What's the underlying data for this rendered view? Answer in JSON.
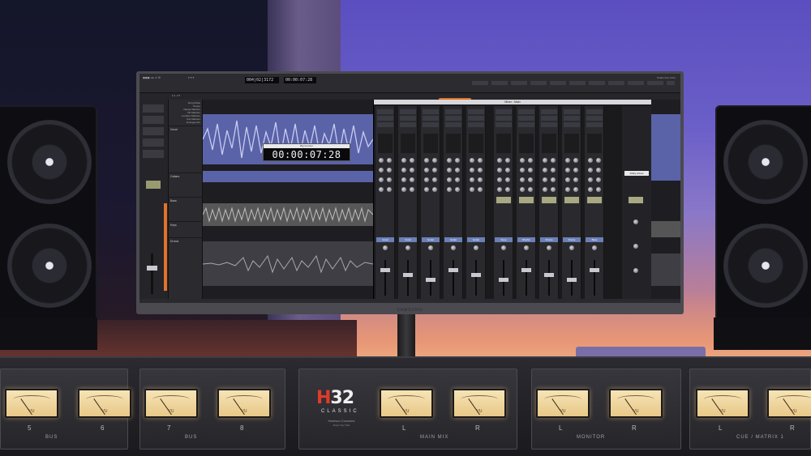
{
  "daw": {
    "transport": {
      "main_counter": "004|02|3172",
      "sub_counter": "00:00:07:28",
      "version": "Studio One 6 Pro"
    },
    "floating_timecode": {
      "title": "Big Counter",
      "value": "00:00:07:28"
    },
    "markers": [
      "Song Mode",
      "Tempo",
      "Range Markers",
      "CD Markers",
      "Location Markers",
      "Cue Markers",
      "Arrangement"
    ],
    "tracks": [
      "Vocal",
      "Guitars",
      "Bass",
      "Keys",
      "Drums"
    ],
    "mixer": {
      "title": "Mixer - Main",
      "channels": [
        "Vocal",
        "Vocal",
        "Guitar",
        "Guitar",
        "Guitar",
        "Keys",
        "Rhythm",
        "Drums",
        "Drums",
        "Bass",
        "Master"
      ],
      "dolby_label": "Dolby Atmos"
    }
  },
  "monitor": {
    "brand": "SAMSUNG"
  },
  "console": {
    "brand": {
      "model_prefix": "H",
      "model_number": "32",
      "line": "CLASSIC",
      "maker": "Harrison Consoles",
      "location": "Music City USA"
    },
    "modules": [
      {
        "meters": [
          "5",
          "6"
        ],
        "label": "BUS"
      },
      {
        "meters": [
          "7",
          "8"
        ],
        "label": "BUS"
      },
      {
        "meters": [
          "L",
          "R"
        ],
        "label": "MAIN MIX"
      },
      {
        "meters": [
          "L",
          "R"
        ],
        "label": "MONITOR"
      },
      {
        "meters": [
          "L",
          "R"
        ],
        "label": "CUE / MATRIX 1"
      }
    ],
    "vu_scale": "VU"
  },
  "colors": {
    "wall": "#6a5ec8",
    "accent_orange": "#e0722a",
    "clip_blue": "#5a62a8",
    "vu_face": "#f6e4b6"
  }
}
